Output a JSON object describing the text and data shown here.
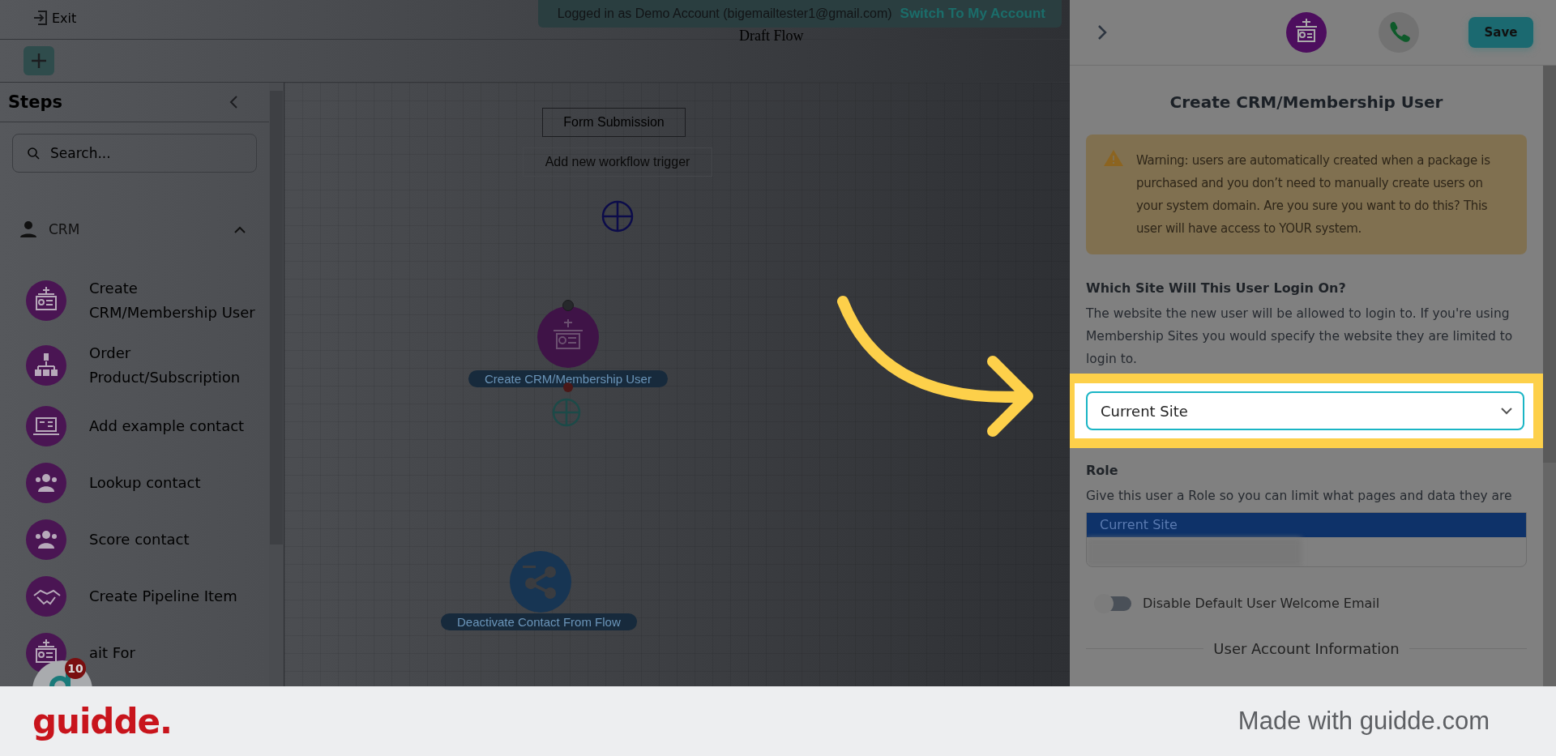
{
  "top_bar": {
    "exit_label": "Exit",
    "banner": {
      "text": "Logged in as Demo Account (bigemailtester1@gmail.com)",
      "link": "Switch To My Account"
    },
    "flow_title": "Draft Flow"
  },
  "sidebar": {
    "title": "Steps",
    "search": {
      "placeholder": "Search..."
    },
    "group": {
      "label": "CRM",
      "expanded": true
    },
    "items": [
      {
        "label": "Create CRM/Membership User"
      },
      {
        "label": "Order Product/Subscription"
      },
      {
        "label": "Add example contact"
      },
      {
        "label": "Lookup contact"
      },
      {
        "label": "Score contact"
      },
      {
        "label": "Create Pipeline Item"
      },
      {
        "label": "ait For"
      }
    ]
  },
  "chat_widget": {
    "badge": "10"
  },
  "canvas": {
    "trigger": "Form Submission",
    "add_trigger": "Add new workflow trigger",
    "nodes": [
      {
        "label": "Create CRM/Membership User",
        "kind": "create-user"
      },
      {
        "label": "Deactivate Contact From Flow",
        "kind": "deactivate"
      }
    ]
  },
  "panel": {
    "save": "Save",
    "title": "Create CRM/Membership User",
    "warning": "Warning: users are automatically created when a package is purchased and you don’t need to manually create users on your system domain. Are you sure you want to do this? This user will have access to YOUR system.",
    "site": {
      "label": "Which Site Will This User Login On?",
      "help": "The website the new user will be allowed to login to. If you're using Membership Sites you would specify the website they are limited to login to.",
      "value": "Current Site"
    },
    "role": {
      "label": "Role",
      "help": "Give this user a Role so you can limit what pages and data they are",
      "options": [
        {
          "label": "Current Site",
          "selected": true
        }
      ]
    },
    "toggle": {
      "label": "Disable Default User Welcome Email",
      "on": false
    },
    "section": "User Account Information"
  },
  "footer": {
    "logo": "guidde.",
    "credit": "Made with guidde.com"
  }
}
